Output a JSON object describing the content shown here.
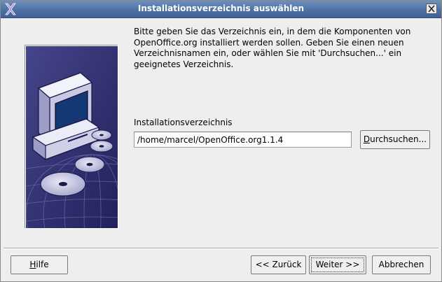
{
  "window": {
    "title": "Installationsverzeichnis auswählen"
  },
  "intro_text": "Bitte geben Sie das Verzeichnis ein, in dem die Komponenten von\nOpenOffice.org installiert werden sollen. Geben Sie einen neuen\nVerzeichnisnamen ein, oder wählen Sie mit 'Durchsuchen...' ein\ngeeignetes Verzeichnis.",
  "install_dir": {
    "label": "Installationsverzeichnis",
    "value": "/home/marcel/OpenOffice.org1.1.4"
  },
  "buttons": {
    "browse": {
      "mnemonic": "D",
      "rest": "urchsuchen..."
    },
    "help": {
      "mnemonic": "H",
      "rest": "ilfe"
    },
    "back": {
      "label": "<< Zurück"
    },
    "next": {
      "label": "Weiter >>"
    },
    "cancel": {
      "label": "Abbrechen"
    }
  },
  "colors": {
    "titlebar": "#4c6fa3",
    "sidebar_bg": "#2d2b6e",
    "monitor_screen": "#1a3a78"
  }
}
